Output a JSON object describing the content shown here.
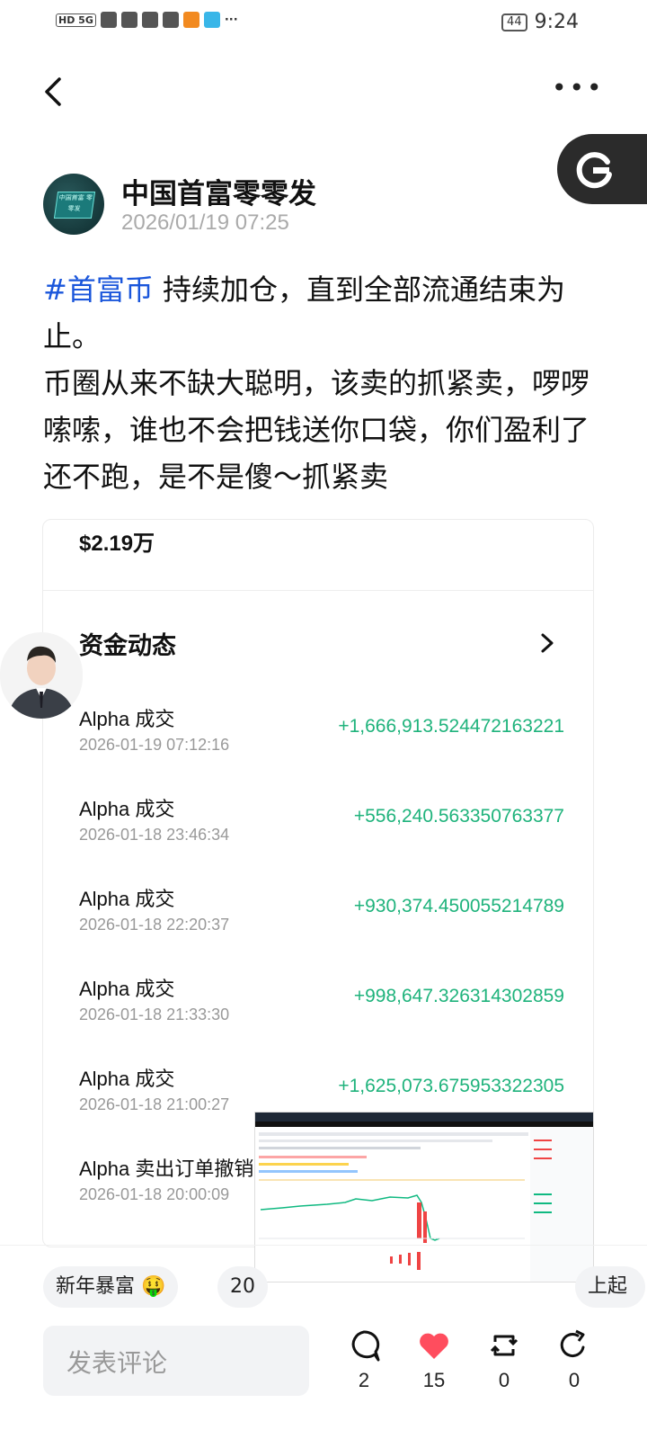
{
  "status_bar": {
    "left_text": "HD 5G",
    "battery": "44",
    "time": "9:24"
  },
  "author": {
    "name": "中国首富零零发",
    "time": "2026/01/19 07:25",
    "avatar_text": "中国首富 零零发"
  },
  "post": {
    "hashtag": "#首富币",
    "text_line1": " 持续加仓，直到全部流通结束为止。",
    "text_rest": "币圈从来不缺大聪明，该卖的抓紧卖，啰啰嗦嗦，谁也不会把钱送你口袋，你们盈利了还不跑，是不是傻～抓紧卖"
  },
  "card": {
    "top_amount": "$2.19万",
    "section_title": "资金动态",
    "transactions": [
      {
        "title": "Alpha 成交",
        "date": "2026-01-19 07:12:16",
        "amount": "+1,666,913.524472163221"
      },
      {
        "title": "Alpha 成交",
        "date": "2026-01-18 23:46:34",
        "amount": "+556,240.563350763377"
      },
      {
        "title": "Alpha 成交",
        "date": "2026-01-18 22:20:37",
        "amount": "+930,374.450055214789"
      },
      {
        "title": "Alpha 成交",
        "date": "2026-01-18 21:33:30",
        "amount": "+998,647.326314302859"
      },
      {
        "title": "Alpha 成交",
        "date": "2026-01-18 21:00:27",
        "amount": "+1,625,073.675953322305"
      },
      {
        "title": "Alpha 卖出订单撤销",
        "date": "2026-01-18 20:00:09",
        "amount": ""
      }
    ]
  },
  "tags": [
    {
      "label": "新年暴富 🤑"
    },
    {
      "label": "20"
    },
    {
      "label": "上起"
    }
  ],
  "bottom": {
    "comment_placeholder": "发表评论",
    "comments": "2",
    "likes": "15",
    "reposts": "0",
    "shares": "0"
  },
  "colors": {
    "hashtag": "#1a56db",
    "gain": "#1fb37c",
    "like": "#ff4d5e"
  }
}
